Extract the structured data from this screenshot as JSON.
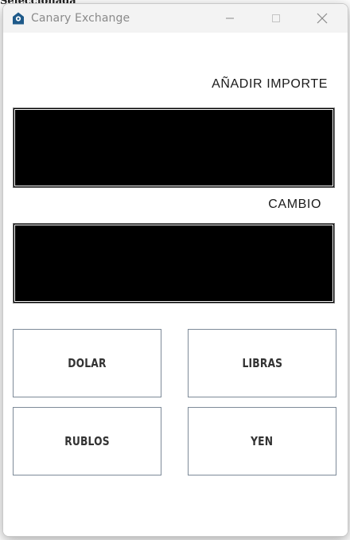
{
  "window": {
    "title": "Canary Exchange",
    "icon": "house-icon",
    "controls": {
      "minimize": "minimize-icon",
      "maximize": "maximize-icon",
      "close": "close-icon"
    }
  },
  "form": {
    "amount_label": "AÑADIR IMPORTE",
    "amount_value": "",
    "exchange_label": "CAMBIO",
    "exchange_value": ""
  },
  "buttons": {
    "dolar": "DOLAR",
    "libras": "LIBRAS",
    "rublos": "RUBLOS",
    "yen": "YEN"
  },
  "colors": {
    "field_bg": "#000000",
    "button_border": "#7d8a98",
    "titlebar_bg": "#f3f3f3",
    "icon_accent": "#1e5a8a"
  }
}
